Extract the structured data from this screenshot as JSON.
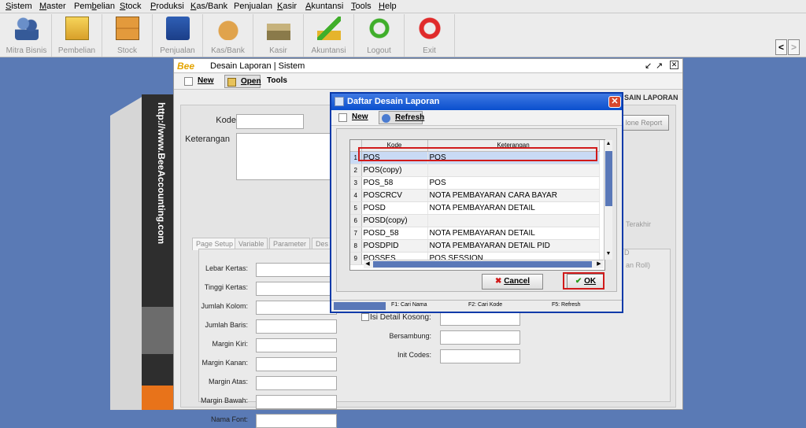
{
  "menubar": {
    "items": [
      {
        "pre": "",
        "u": "S",
        "post": "istem"
      },
      {
        "pre": "",
        "u": "M",
        "post": "aster"
      },
      {
        "pre": "Pem",
        "u": "b",
        "post": "elian"
      },
      {
        "pre": "",
        "u": "S",
        "post": "tock"
      },
      {
        "pre": "",
        "u": "P",
        "post": "roduksi"
      },
      {
        "pre": "",
        "u": "K",
        "post": "as/Bank"
      },
      {
        "pre": "Pen",
        "u": "j",
        "post": "ualan"
      },
      {
        "pre": "",
        "u": "K",
        "post": "asir"
      },
      {
        "pre": "",
        "u": "A",
        "post": "kuntansi"
      },
      {
        "pre": "",
        "u": "T",
        "post": "ools"
      },
      {
        "pre": "",
        "u": "H",
        "post": "elp"
      }
    ]
  },
  "toolbar": {
    "buttons": [
      {
        "label": "Mitra Bisnis",
        "icon": "users-icon"
      },
      {
        "label": "Pembelian",
        "icon": "purchase-icon"
      },
      {
        "label": "Stock",
        "icon": "boxes-icon"
      },
      {
        "label": "Penjualan",
        "icon": "shopping-bag-icon"
      },
      {
        "label": "Kas/Bank",
        "icon": "money-bag-icon"
      },
      {
        "label": "Kasir",
        "icon": "cashier-icon"
      },
      {
        "label": "Akuntansi",
        "icon": "chart-growth-icon"
      },
      {
        "label": "Logout",
        "icon": "logout-arrow-icon"
      },
      {
        "label": "Exit",
        "icon": "power-icon"
      }
    ],
    "nav_left": "<",
    "nav_right": ">"
  },
  "side_brand": {
    "url": "http://www.BeeAccounting.com",
    "accounting": "accounting"
  },
  "frame": {
    "logo": "Bee",
    "title": "Desain Laporan | Sistem",
    "toolbar": {
      "new": "New",
      "open": "Open",
      "tools": "Tools"
    },
    "header_right": "SAIN LAPORAN",
    "clone_button": "lone Report",
    "fields": {
      "kode": "Kode",
      "keterangan": "Keterangan"
    },
    "tabs": [
      "Page Setup",
      "Variable",
      "Parameter",
      "Des"
    ],
    "page_setup": {
      "left_labels": [
        "Lebar Kertas:",
        "Tinggi Kertas:",
        "Jumlah Kolom:",
        "Jumlah Baris:",
        "Margin Kiri:",
        "Margin Kanan:",
        "Margin Atas:",
        "Margin Bawah:",
        "Nama Font:"
      ],
      "isi_detail": "Isi Detail Kosong:",
      "bersambung": "Bersambung:",
      "init_codes": "Init Codes:",
      "right_partial1": "Terakhir",
      "right_partial2": "an Roll)",
      "right_partial3": "D"
    }
  },
  "dialog": {
    "title": "Daftar Desain Laporan",
    "toolbar": {
      "new": "New",
      "refresh": "Refresh"
    },
    "columns": [
      "Kode",
      "Keterangan"
    ],
    "rows": [
      {
        "no": "1",
        "kode": "POS",
        "keterangan": "POS"
      },
      {
        "no": "2",
        "kode": "POS(copy)",
        "keterangan": ""
      },
      {
        "no": "3",
        "kode": "POS_58",
        "keterangan": "POS"
      },
      {
        "no": "4",
        "kode": "POSCRCV",
        "keterangan": "NOTA PEMBAYARAN CARA BAYAR"
      },
      {
        "no": "5",
        "kode": "POSD",
        "keterangan": "NOTA PEMBAYARAN DETAIL"
      },
      {
        "no": "6",
        "kode": "POSD(copy)",
        "keterangan": ""
      },
      {
        "no": "7",
        "kode": "POSD_58",
        "keterangan": "NOTA PEMBAYARAN DETAIL"
      },
      {
        "no": "8",
        "kode": "POSDPID",
        "keterangan": "NOTA PEMBAYARAN DETAIL PID"
      },
      {
        "no": "9",
        "kode": "POSSES",
        "keterangan": "POS SESSION"
      }
    ],
    "selected_row": 1,
    "buttons": {
      "cancel": "Cancel",
      "ok": "OK"
    },
    "status": {
      "f1": "F1: Cari Nama",
      "f2": "F2: Cari Kode",
      "f5": "F5: Refresh"
    }
  },
  "colors": {
    "desktop": "#5a7ab5",
    "dialog_title": "#0a4fce",
    "highlight": "#d11a1a",
    "selection": "#c9daf4"
  }
}
